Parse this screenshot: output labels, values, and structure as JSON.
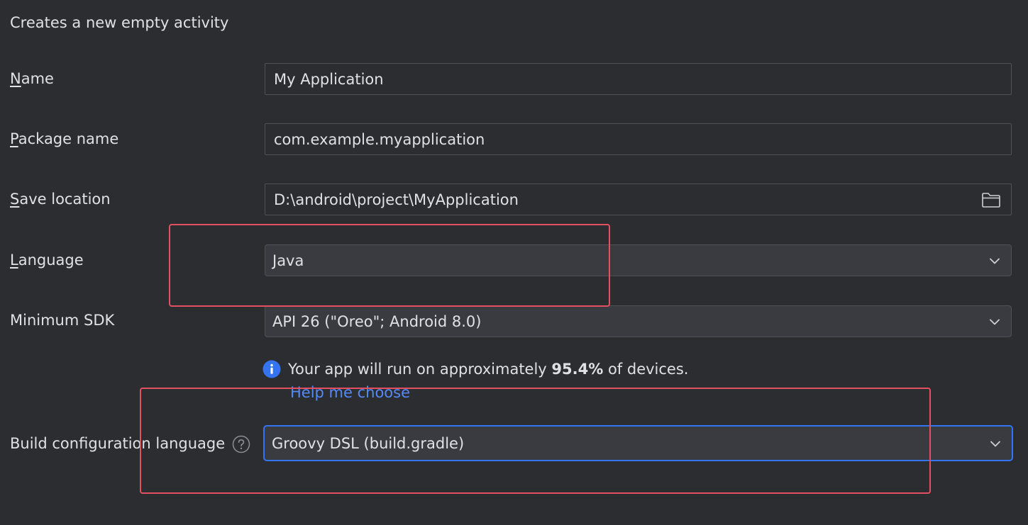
{
  "description": "Creates a new empty activity",
  "form": {
    "name": {
      "label_mnemonic": "N",
      "label_rest": "ame",
      "value": "My Application"
    },
    "package": {
      "label_mnemonic": "P",
      "label_rest": "ackage name",
      "value": "com.example.myapplication"
    },
    "save_location": {
      "label_mnemonic": "S",
      "label_rest": "ave location",
      "value": "D:\\android\\project\\MyApplication",
      "browse_icon": "folder-icon"
    },
    "language": {
      "label_mnemonic": "L",
      "label_rest": "anguage",
      "selected": "Java"
    },
    "min_sdk": {
      "label": "Minimum SDK",
      "selected": "API 26 (\"Oreo\"; Android 8.0)"
    },
    "sdk_info": {
      "prefix": "Your app will run on approximately ",
      "percent": "95.4%",
      "suffix": " of devices.",
      "help_link": "Help me choose",
      "icon": "info-icon"
    },
    "build_config": {
      "label": "Build configuration language",
      "selected": "Groovy DSL (build.gradle)",
      "help_icon": "question-icon"
    }
  },
  "colors": {
    "background": "#2b2d30",
    "field_border": "#4e5157",
    "combo_bg": "#393b40",
    "focus_border": "#3574f0",
    "link": "#548af7",
    "annotation_red": "#e4505f"
  }
}
